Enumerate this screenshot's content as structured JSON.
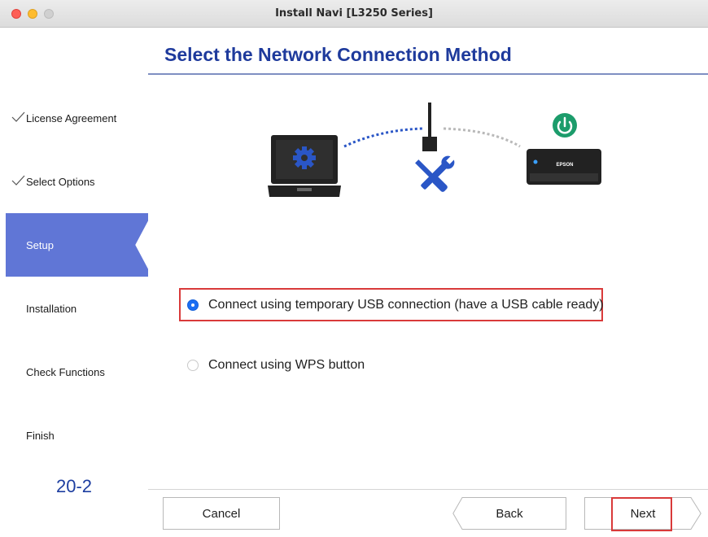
{
  "window": {
    "title": "Install Navi [L3250 Series]"
  },
  "sidebar": {
    "steps": [
      {
        "label": "License Agreement",
        "state": "done"
      },
      {
        "label": "Select Options",
        "state": "done"
      },
      {
        "label": "Setup",
        "state": "active"
      },
      {
        "label": "Installation",
        "state": "pending"
      },
      {
        "label": "Check Functions",
        "state": "pending"
      },
      {
        "label": "Finish",
        "state": "pending"
      }
    ],
    "page_number": "20-2"
  },
  "main": {
    "title": "Select the Network Connection Method",
    "illustration": {
      "printer_brand": "EPSON",
      "icons": [
        "laptop-icon",
        "gear-icon",
        "router-icon",
        "wrench-screwdriver-icon",
        "power-icon",
        "printer-icon"
      ]
    },
    "options": [
      {
        "label": "Connect using temporary USB connection (have a USB cable ready)",
        "selected": true
      },
      {
        "label": "Connect using WPS button",
        "selected": false
      }
    ]
  },
  "buttons": {
    "cancel": "Cancel",
    "back": "Back",
    "next": "Next"
  },
  "colors": {
    "accent": "#6076d6",
    "title": "#1e3a9c",
    "radio": "#1b6ef3",
    "highlight": "#d93a3a"
  }
}
